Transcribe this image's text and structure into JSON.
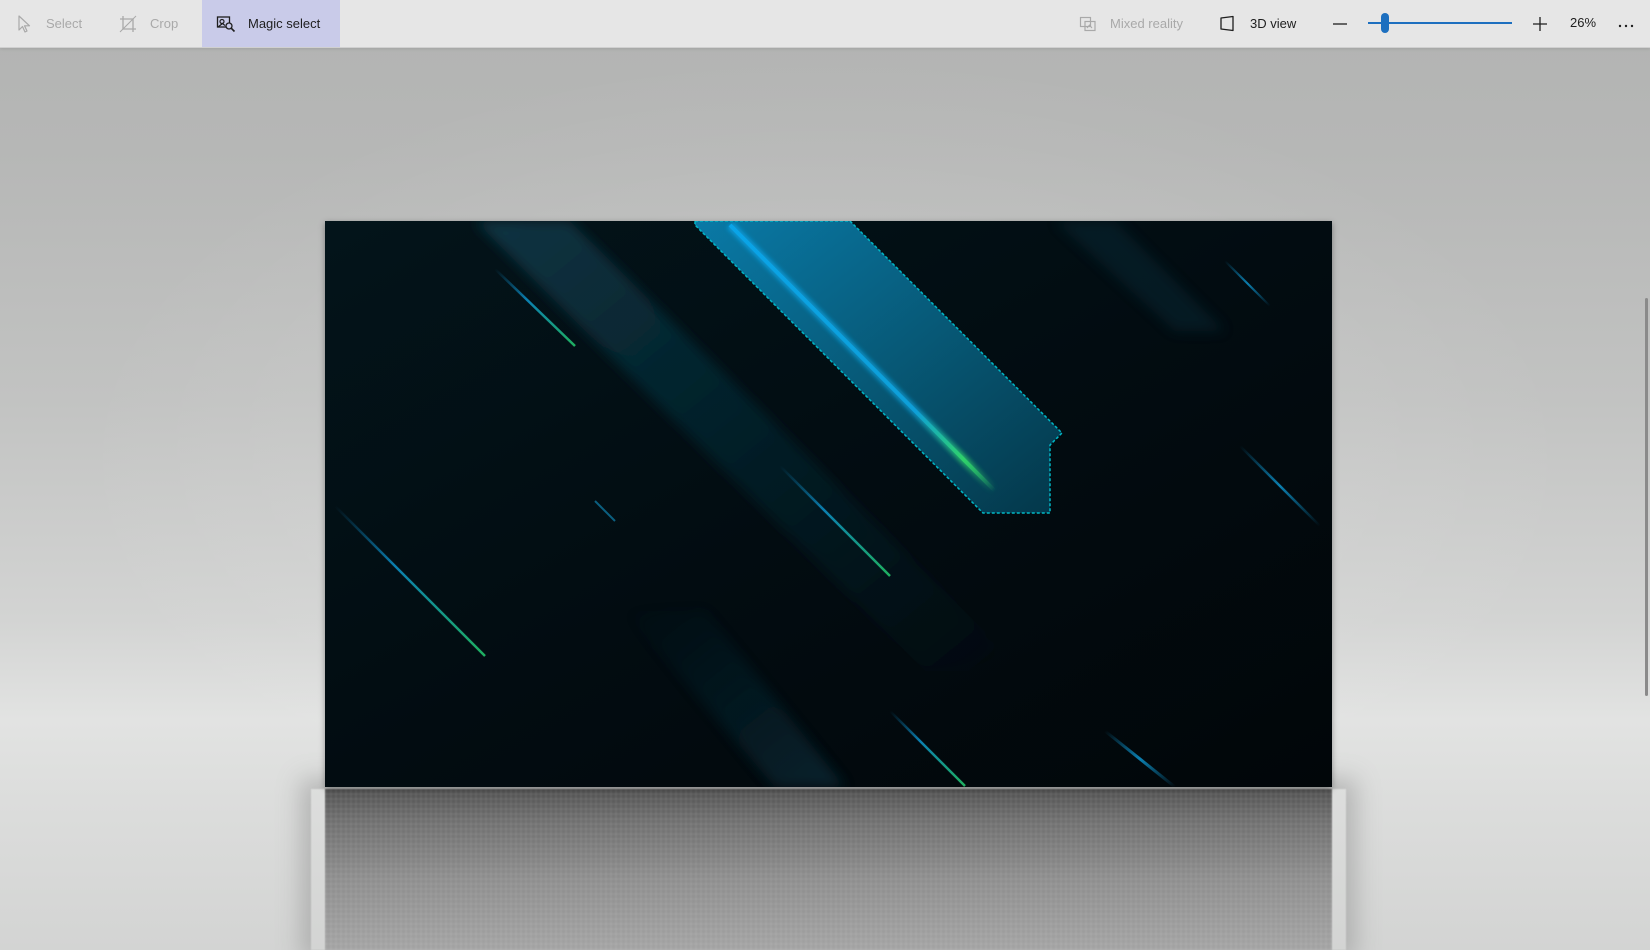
{
  "toolbar": {
    "tools": {
      "select": {
        "label": "Select",
        "icon": "cursor-arrow-icon",
        "enabled": false
      },
      "crop": {
        "label": "Crop",
        "icon": "crop-icon",
        "enabled": false
      },
      "magic_select": {
        "label": "Magic select",
        "icon": "magic-select-icon",
        "active": true
      }
    },
    "mixed_reality": {
      "label": "Mixed reality",
      "icon": "mixed-reality-icon",
      "enabled": false
    },
    "view_3d": {
      "label": "3D view",
      "icon": "3d-view-icon"
    },
    "zoom": {
      "percent_label": "26%",
      "slider_fraction": 0.12,
      "minus_icon": "minus-icon",
      "plus_icon": "plus-icon"
    },
    "more_icon": "more-ellipsis-icon"
  },
  "colors": {
    "accent": "#1d6fbf",
    "active_tool_bg": "#c9cbe9",
    "canvas_bg": "#020b10",
    "selection_outline": "#00b7c6",
    "streak_blue": "#0aa4e8",
    "streak_green": "#2fd16a"
  }
}
